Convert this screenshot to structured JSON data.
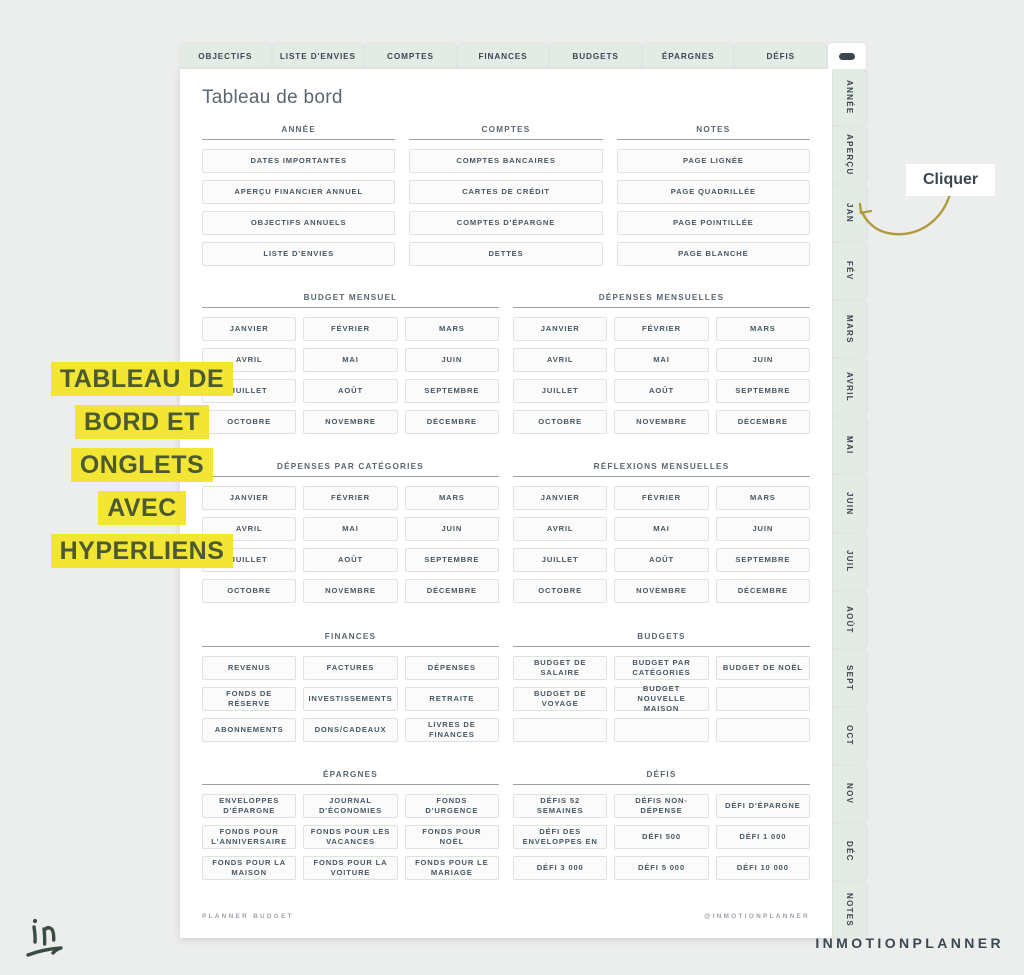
{
  "brand": {
    "wordmark": "INMOTIONPLANNER",
    "logo_icon": "in-logo-icon"
  },
  "top_tabs": [
    {
      "label": "OBJECTIFS"
    },
    {
      "label": "LISTE D'ENVIES"
    },
    {
      "label": "COMPTES"
    },
    {
      "label": "FINANCES"
    },
    {
      "label": "BUDGETS"
    },
    {
      "label": "ÉPARGNES"
    },
    {
      "label": "DÉFIS"
    }
  ],
  "menu_tab": {
    "icon": "menu-pill-icon"
  },
  "side_tabs": [
    {
      "label": "ANNÉE"
    },
    {
      "label": "APERÇU"
    },
    {
      "label": "JAN"
    },
    {
      "label": "FÉV"
    },
    {
      "label": "MARS"
    },
    {
      "label": "AVRIL"
    },
    {
      "label": "MAI"
    },
    {
      "label": "JUIN"
    },
    {
      "label": "JUIL"
    },
    {
      "label": "AOÛT"
    },
    {
      "label": "SEPT"
    },
    {
      "label": "OCT"
    },
    {
      "label": "NOV"
    },
    {
      "label": "DÉC"
    },
    {
      "label": "NOTES"
    }
  ],
  "page": {
    "title": "Tableau de bord",
    "footer_left": "PLANNER BUDGET",
    "footer_right": "@INMOTIONPLANNER"
  },
  "bands": [
    {
      "name": "band-top",
      "columns": [
        {
          "heading": "ANNÉE",
          "rows": [
            [
              "DATES IMPORTANTES"
            ],
            [
              "APERÇU FINANCIER ANNUEL"
            ],
            [
              "OBJECTIFS ANNUELS"
            ],
            [
              "LISTE D'ENVIES"
            ]
          ]
        },
        {
          "heading": "COMPTES",
          "rows": [
            [
              "COMPTES BANCAIRES"
            ],
            [
              "CARTES DE CRÉDIT"
            ],
            [
              "COMPTES D'ÉPARGNE"
            ],
            [
              "DETTES"
            ]
          ]
        },
        {
          "heading": "NOTES",
          "rows": [
            [
              "PAGE LIGNÉE"
            ],
            [
              "PAGE QUADRILLÉE"
            ],
            [
              "PAGE POINTILLÉE"
            ],
            [
              "PAGE BLANCHE"
            ]
          ]
        }
      ]
    },
    {
      "name": "band-monthly-1",
      "columns": [
        {
          "heading": "BUDGET MENSUEL",
          "rows": [
            [
              "JANVIER",
              "FÉVRIER",
              "MARS"
            ],
            [
              "AVRIL",
              "MAI",
              "JUIN"
            ],
            [
              "JUILLET",
              "AOÛT",
              "SEPTEMBRE"
            ],
            [
              "OCTOBRE",
              "NOVEMBRE",
              "DÉCEMBRE"
            ]
          ]
        },
        {
          "heading": "DÉPENSES MENSUELLES",
          "rows": [
            [
              "JANVIER",
              "FÉVRIER",
              "MARS"
            ],
            [
              "AVRIL",
              "MAI",
              "JUIN"
            ],
            [
              "JUILLET",
              "AOÛT",
              "SEPTEMBRE"
            ],
            [
              "OCTOBRE",
              "NOVEMBRE",
              "DÉCEMBRE"
            ]
          ]
        }
      ]
    },
    {
      "name": "band-monthly-2",
      "columns": [
        {
          "heading": "DÉPENSES PAR CATÉGORIES",
          "rows": [
            [
              "JANVIER",
              "FÉVRIER",
              "MARS"
            ],
            [
              "AVRIL",
              "MAI",
              "JUIN"
            ],
            [
              "JUILLET",
              "AOÛT",
              "SEPTEMBRE"
            ],
            [
              "OCTOBRE",
              "NOVEMBRE",
              "DÉCEMBRE"
            ]
          ]
        },
        {
          "heading": "RÉFLEXIONS MENSUELLES",
          "rows": [
            [
              "JANVIER",
              "FÉVRIER",
              "MARS"
            ],
            [
              "AVRIL",
              "MAI",
              "JUIN"
            ],
            [
              "JUILLET",
              "AOÛT",
              "SEPTEMBRE"
            ],
            [
              "OCTOBRE",
              "NOVEMBRE",
              "DÉCEMBRE"
            ]
          ]
        }
      ]
    },
    {
      "name": "band-finances",
      "columns": [
        {
          "heading": "FINANCES",
          "rows": [
            [
              "REVENUS",
              "FACTURES",
              "DÉPENSES"
            ],
            [
              "FONDS DE RÉSERVE",
              "INVESTISSEMENTS",
              "RETRAITE"
            ],
            [
              "ABONNEMENTS",
              "DONS/CADEAUX",
              "LIVRES DE FINANCES"
            ]
          ]
        },
        {
          "heading": "BUDGETS",
          "rows": [
            [
              "BUDGET DE SALAIRE",
              "BUDGET PAR CATÉGORIES",
              "BUDGET DE NOËL"
            ],
            [
              "BUDGET DE VOYAGE",
              "BUDGET NOUVELLE MAISON",
              ""
            ],
            [
              "",
              "",
              ""
            ]
          ]
        }
      ]
    },
    {
      "name": "band-epargnes",
      "columns": [
        {
          "heading": "ÉPARGNES",
          "rows": [
            [
              "ENVELOPPES D'ÉPARGNE",
              "JOURNAL D'ÉCONOMIES",
              "FONDS D'URGENCE"
            ],
            [
              "FONDS POUR L'ANNIVERSAIRE",
              "FONDS POUR LES VACANCES",
              "FONDS POUR NOËL"
            ],
            [
              "FONDS POUR LA MAISON",
              "FONDS POUR LA VOITURE",
              "FONDS POUR LE MARIAGE"
            ]
          ]
        },
        {
          "heading": "DÉFIS",
          "rows": [
            [
              "DÉFIS 52 SEMAINES",
              "DÉFIS NON-DÉPENSE",
              "DÉFI D'ÉPARGNE"
            ],
            [
              "DÉFI DES ENVELOPPES EN",
              "DÉFI 500",
              "DÉFI 1 000"
            ],
            [
              "DÉFI 3 000",
              "DÉFI 5 000",
              "DÉFI 10 000"
            ]
          ]
        }
      ]
    }
  ],
  "annotations": {
    "highlight_lines": [
      "TABLEAU DE",
      "BORD ET",
      "ONGLETS",
      "AVEC",
      "HYPERLIENS"
    ],
    "highlight_color": "#f3e534",
    "highlight_text_color": "#4c5a32",
    "callout_label": "Cliquer",
    "arrow_color": "#b09a3e"
  }
}
